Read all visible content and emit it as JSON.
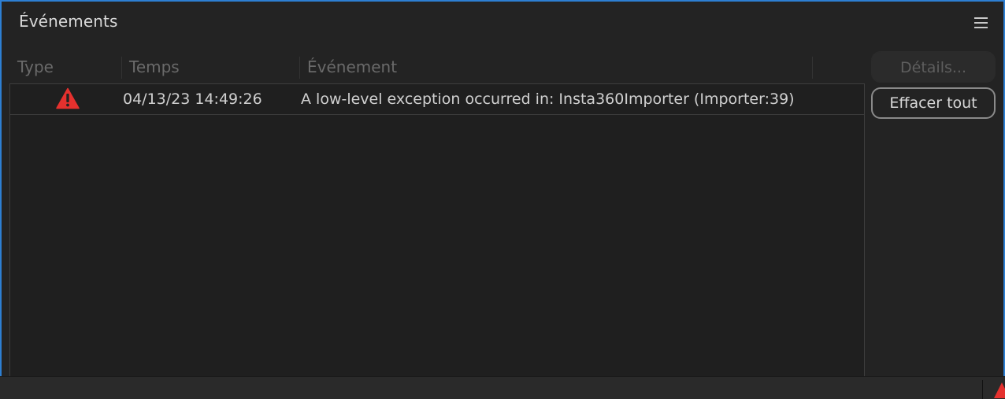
{
  "panel": {
    "title": "Événements",
    "menu_icon": "hamburger-menu-icon"
  },
  "table": {
    "columns": [
      "Type",
      "Temps",
      "Événement"
    ],
    "rows": [
      {
        "type_icon": "warning-triangle-icon",
        "time": "04/13/23 14:49:26",
        "event": "A low-level exception occurred in: Insta360Importer (Importer:39)"
      }
    ]
  },
  "buttons": {
    "details": "Détails...",
    "clear_all": "Effacer tout"
  },
  "status_bar": {
    "icon": "warning-triangle-icon"
  },
  "colors": {
    "accent_border": "#2d7fd3",
    "warning": "#e5312e",
    "panel_bg": "#232323"
  }
}
